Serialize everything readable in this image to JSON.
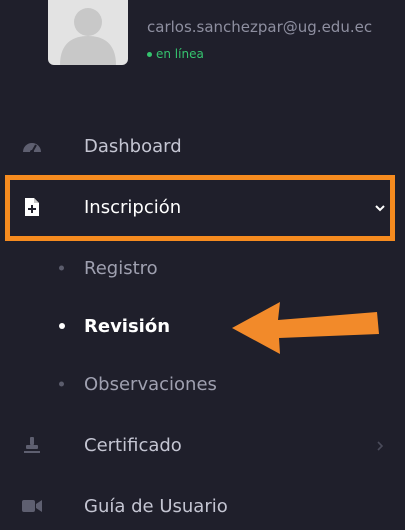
{
  "user": {
    "email": "carlos.sanchezpar@ug.edu.ec",
    "status": "en línea"
  },
  "menu": {
    "dashboard": "Dashboard",
    "inscripcion": "Inscripción",
    "submenu": {
      "registro": "Registro",
      "revision": "Revisión",
      "observaciones": "Observaciones"
    },
    "certificado": "Certificado",
    "guia": "Guía de Usuario"
  },
  "colors": {
    "sidebar_bg": "#1f1f2b",
    "highlight": "#f68b1f",
    "status_green": "#35c46f"
  },
  "icons": {
    "dashboard": "speedometer-icon",
    "inscripcion": "file-add-icon",
    "certificado": "stamp-icon",
    "guia": "video-camera-icon"
  }
}
